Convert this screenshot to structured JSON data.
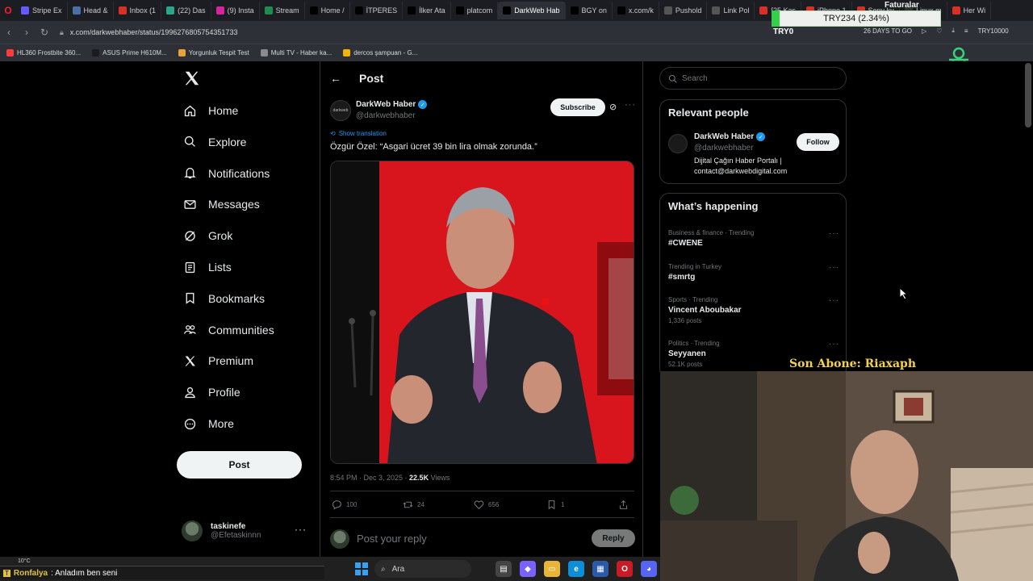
{
  "browser": {
    "tabs": [
      {
        "label": "Stripe Ex",
        "color": "#635bff"
      },
      {
        "label": "Head &",
        "color": "#4a6fa5"
      },
      {
        "label": "Inbox (1",
        "color": "#d93025"
      },
      {
        "label": "(22) Das",
        "color": "#2ca58d"
      },
      {
        "label": "(9) Insta",
        "color": "#d6249f"
      },
      {
        "label": "Stream",
        "color": "#1f8b4c"
      },
      {
        "label": "Home /",
        "color": "#000000"
      },
      {
        "label": "İTPERES",
        "color": "#000000"
      },
      {
        "label": "İlker Ata",
        "color": "#000000"
      },
      {
        "label": "platcom",
        "color": "#000000"
      },
      {
        "label": "DarkWeb Hab",
        "color": "#000000",
        "active": true
      },
      {
        "label": "BGY on",
        "color": "#000000"
      },
      {
        "label": "x.com/k",
        "color": "#000000"
      },
      {
        "label": "Pushold",
        "color": "#555555"
      },
      {
        "label": "Link Pol",
        "color": "#555555"
      },
      {
        "label": "[25 Kas",
        "color": "#d93025"
      },
      {
        "label": "iPhone 1",
        "color": "#d93025"
      },
      {
        "label": "Sony ku",
        "color": "#d93025"
      },
      {
        "label": "Linux m",
        "color": "#333333"
      },
      {
        "label": "Her Wi",
        "color": "#d93025"
      }
    ],
    "url": "x.com/darkwebhaber/status/1996276805754351733",
    "bookmarks": [
      {
        "label": "HL360 Frostbite 360...",
        "color": "#ff3b3b"
      },
      {
        "label": "ASUS Prime H610M...",
        "color": "#1b1b1b"
      },
      {
        "label": "Yorgunluk Tespit Test",
        "color": "#e9a13b"
      },
      {
        "label": "Multi TV - Haber ka...",
        "color": "#8a8a8a"
      },
      {
        "label": "dercos şampuan - G...",
        "color": "#f4b400"
      }
    ]
  },
  "overlay": {
    "ticker_title": "Faturalar",
    "ticker_value": "TRY234 (2.34%)",
    "ticker_code": "TRY0",
    "toolbar_items": [
      "26 DAYS TO GO",
      "TRY10000"
    ],
    "son_abone": "Son Abone: Riaxaph",
    "chat_user": "Ronfalya",
    "chat_message": ": Anladım ben seni",
    "weather": "10°C",
    "taskbar_search": "Ara"
  },
  "nav": {
    "items": [
      {
        "label": "Home",
        "icon": "home-icon"
      },
      {
        "label": "Explore",
        "icon": "search-icon"
      },
      {
        "label": "Notifications",
        "icon": "bell-icon"
      },
      {
        "label": "Messages",
        "icon": "mail-icon"
      },
      {
        "label": "Grok",
        "icon": "grok-icon"
      },
      {
        "label": "Lists",
        "icon": "list-icon"
      },
      {
        "label": "Bookmarks",
        "icon": "bookmark-icon"
      },
      {
        "label": "Communities",
        "icon": "people-icon"
      },
      {
        "label": "Premium",
        "icon": "x-logo-icon"
      },
      {
        "label": "Profile",
        "icon": "person-icon"
      },
      {
        "label": "More",
        "icon": "more-circle-icon"
      }
    ],
    "post_button": "Post",
    "account": {
      "name": "taskinefe",
      "handle": "@Efetaskinnn"
    }
  },
  "post": {
    "header_title": "Post",
    "author_name": "DarkWeb Haber",
    "author_handle": "@darkwebhaber",
    "subscribe_label": "Subscribe",
    "show_translation": "Show translation",
    "text": "Özgür Özel: “Asgari ücret 39 bin lira olmak zorunda.”",
    "timestamp": "8:54 PM · Dec 3, 2025 · ",
    "views_count": "22.5K",
    "views_label": " Views",
    "replies": "100",
    "reposts": "24",
    "likes": "656",
    "bookmarks": "1",
    "reply_placeholder": "Post your reply",
    "reply_button": "Reply"
  },
  "sidebar": {
    "search_placeholder": "Search",
    "relevant_title": "Relevant people",
    "relevant_person": {
      "name": "DarkWeb Haber",
      "handle": "@darkwebhaber",
      "bio": "Dijital Çağın Haber Portalı | contact@darkwebdigital.com",
      "follow_label": "Follow"
    },
    "happening_title": "What’s happening",
    "trends": [
      {
        "meta": "Business & finance · Trending",
        "name": "#CWENE",
        "count": ""
      },
      {
        "meta": "Trending in Turkey",
        "name": "#smrtg",
        "count": ""
      },
      {
        "meta": "Sports · Trending",
        "name": "Vincent Aboubakar",
        "count": "1,336 posts"
      },
      {
        "meta": "Politics · Trending",
        "name": "Seyyanen",
        "count": "52.1K posts"
      }
    ]
  },
  "colors": {
    "accent": "#1d9bf0",
    "background": "#000000",
    "border": "#2f3336",
    "muted": "#71767b"
  }
}
